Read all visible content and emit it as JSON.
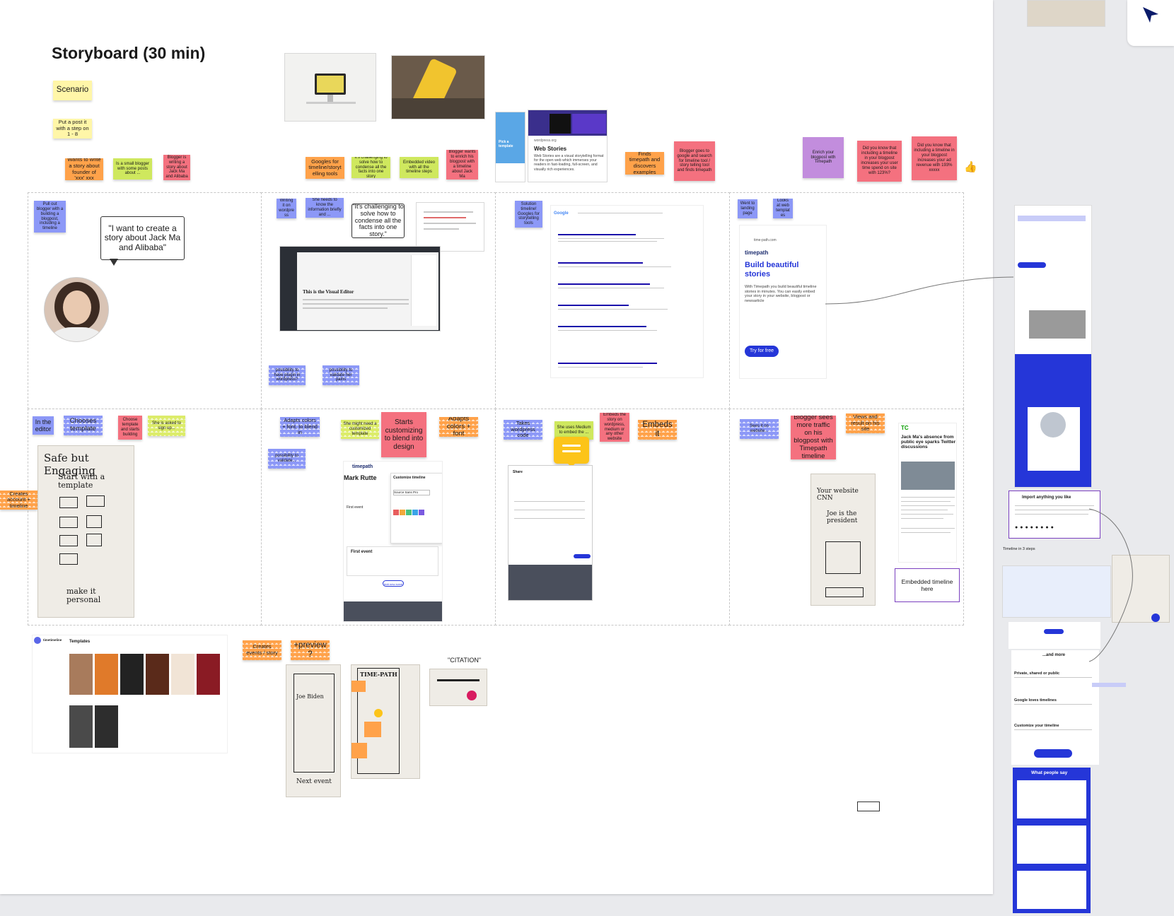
{
  "board": {
    "title": "Storyboard (30 min)"
  },
  "notes": {
    "scenario": "Scenario",
    "put_post": "Put a post it with a step on 1 - 8",
    "n1": "Wants to write a story about founder of 'xxx' xxx",
    "n2": "Is a small blogger with some posts about ...",
    "n3": "Blogger is writing a story about Jack Ma and Alibaba",
    "n4": "Googles for timeline/storytelling tools",
    "n5": "It's challenging to solve how to condense all the facts into one story",
    "n6": "Embedded video with all the timeline steps",
    "n7": "Blogger wants to enrich his blogpost with a timeline about Jack Ma",
    "n8": "Finds timepath and discovers examples",
    "n9": "Blogger goes to google and search for timeline tool / story telling tool and finds timepath",
    "n10": "Enrich your blogpost with Timepath",
    "n11": "Did you know that including a timeline in your blogpost increases your user time spend on site with 123%?",
    "n12": "Did you know that including a timeline in your blogpost increases your ad revenue with 193% xxxxx",
    "thumb": "👍",
    "p1_note": "Pull out blogger with a building a blogpost, including a timeline",
    "p1_quote": "\"I want to create a story about Jack Ma and Alibaba\"",
    "p2_a": "Writing it on wordpress",
    "p2_b": "She needs to know the information briefly and ...",
    "p2_quote": "\"It's challenging to solve how to condense all the facts into one story.\"",
    "p2_c": "possibility to have plugin in wordpress?",
    "p2_d": "possibility to validate her pains",
    "p3_a": "Solution timeline! Googles for storytelling tools",
    "p4_a": "Went to landing page",
    "p4_b": "Looks at web templates",
    "p5_a": "In the editor",
    "p5_b": "Chooses template",
    "p5_c": "Choose template and starts building",
    "p5_d": "She is asked to sign up...",
    "creates_account": "Creates account + timeline",
    "p6_a": "Adapts colors + font, to blend in",
    "p6_b": "She might need a customized template",
    "p6_c": "Starts customizing to blend into design",
    "p6_d": "Adapts colors + font",
    "p6_e": "possibility to validate...",
    "p7_a": "Takes wordpress code",
    "p7_b": "She uses Medium to embed the ...",
    "p7_c": "Embeds the story on wordpress, medium or any other website",
    "p7_d": "Embeds it",
    "p8_a": "Sees it on website...",
    "p8_b": "Blogger sees more traffic on his blogpost with Timepath timeline",
    "p8_c": "Views and result on his site",
    "creates_events": "Creates events / story",
    "preview": "+preview?",
    "citation": "\"CITATION\""
  },
  "webstories": {
    "title": "Web Stories",
    "source": "wordpress.org",
    "desc": "Web Stories are a visual storytelling format for the open web which immerses your readers in fast-loading, full-screen, and visually rich experiences."
  },
  "landing": {
    "url": "time-path.com",
    "brand": "timepath",
    "headline": "Build beautiful stories",
    "body": "With Timepath you build beautiful timeline stories in minutes. You can easily embed your story in your website, blogpost or newsarticle",
    "cta": "Try for free"
  },
  "editor": {
    "brand": "timepath",
    "name": "Mark Rutte",
    "event": "First event",
    "add": "Add new event",
    "panel": "Customize timeline",
    "font": "Source Sans Pro"
  },
  "share": {
    "title": "Share"
  },
  "news": {
    "logo": "TC",
    "headline": "Jack Ma's absence from public eye sparks Twitter discussions",
    "embed": "Embedded timeline here"
  },
  "sidebar": {
    "import": "Import anything you like",
    "more": "...and more",
    "private": "Private, shared or public",
    "google": "Google loves timelines",
    "custom": "Customize your timeline",
    "say": "What people say",
    "timeline3": "Timeline in 3 steps"
  },
  "templates": {
    "brand": "timetimeline",
    "label": "Templates"
  },
  "sketch": {
    "safe": "Safe but Engaging",
    "start": "Start with a template",
    "personal": "make it personal",
    "joe": "Joe Biden",
    "next": "Next event",
    "timepath": "TIME-PATH",
    "cnn": "Your website CNN",
    "joe2": "Joe is the president"
  },
  "colors": {
    "yellow": "#fff6a8",
    "orange": "#ffa24a",
    "green": "#cfe85e",
    "pink": "#f4717f",
    "purple": "#c28ddd",
    "blue": "#8c98f7",
    "accent": "#2536d8"
  }
}
